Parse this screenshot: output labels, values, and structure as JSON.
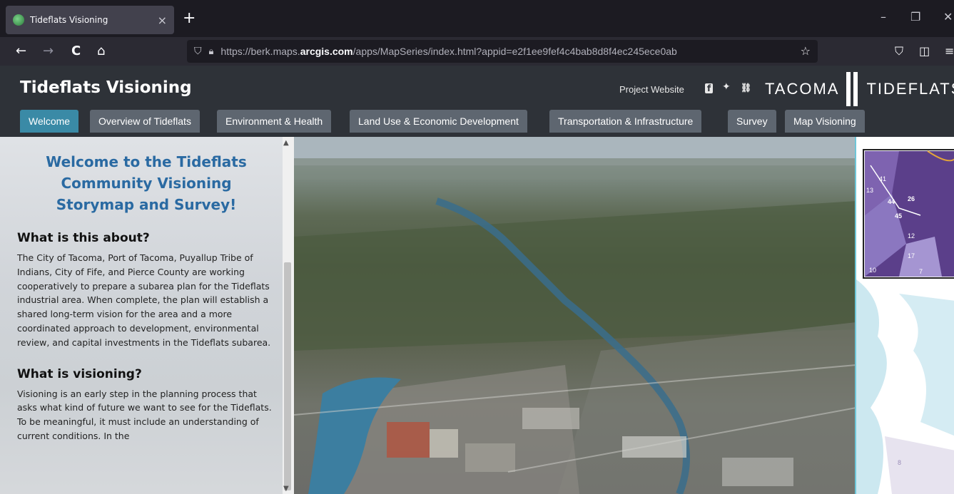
{
  "browser": {
    "tab_title": "Tideflats Visioning",
    "tab_close": "×",
    "new_tab": "+",
    "minimize": "–",
    "restore": "❐",
    "close": "✕",
    "back": "←",
    "forward": "→",
    "reload": "C",
    "home": "⌂",
    "url_prefix": "https://berk.maps.",
    "url_domain": "arcgis.com",
    "url_suffix": "/apps/MapSeries/index.html?appid=e2f1ee9fef4c4bab8d8f4ec245ece0ab",
    "bookmark": "☆",
    "pocket": "⛉",
    "sidebar": "◫",
    "menu": "≡"
  },
  "header": {
    "title": "Tideflats Visioning",
    "project_link": "Project Website",
    "facebook": "f",
    "twitter": "✦",
    "link": "⛓",
    "logo_left": "TACOMA",
    "logo_right": "TIDEFLATS"
  },
  "tabs": [
    {
      "label": "Welcome",
      "active": true
    },
    {
      "label": "Overview of Tideflats",
      "active": false
    },
    {
      "label": "Environment & Health",
      "active": false
    },
    {
      "label": "Land Use & Economic Development",
      "active": false
    },
    {
      "label": "Transportation & Infrastructure",
      "active": false
    },
    {
      "label": "Survey",
      "active": false
    },
    {
      "label": "Map Visioning",
      "active": false
    }
  ],
  "panel": {
    "welcome_heading": "Welcome to the Tideflats Community Visioning Storymap and Survey!",
    "section1_heading": "What is this about?",
    "section1_text": "The City of Tacoma, Port of Tacoma, Puyallup Tribe of Indians, City of Fife, and Pierce County are working cooperatively to prepare a subarea plan for the Tideflats industrial area. When complete, the plan will establish a shared long-term vision for the area and a more coordinated approach to development, environmental review, and capital investments in the Tideflats subarea.",
    "section2_heading": "What is visioning?",
    "section2_text": "Visioning is an early step in the planning process that asks what kind of future we want to see for the Tideflats. To be meaningful, it must include an understanding of current conditions. In the"
  },
  "map": {
    "labels": [
      "13",
      "41",
      "44",
      "26",
      "45",
      "12",
      "17",
      "10",
      "7",
      "8"
    ]
  },
  "colors": {
    "active_tab": "#3a8aa6",
    "tab": "#5e6670",
    "header": "#2e3238",
    "heading_blue": "#2a6aa2"
  }
}
